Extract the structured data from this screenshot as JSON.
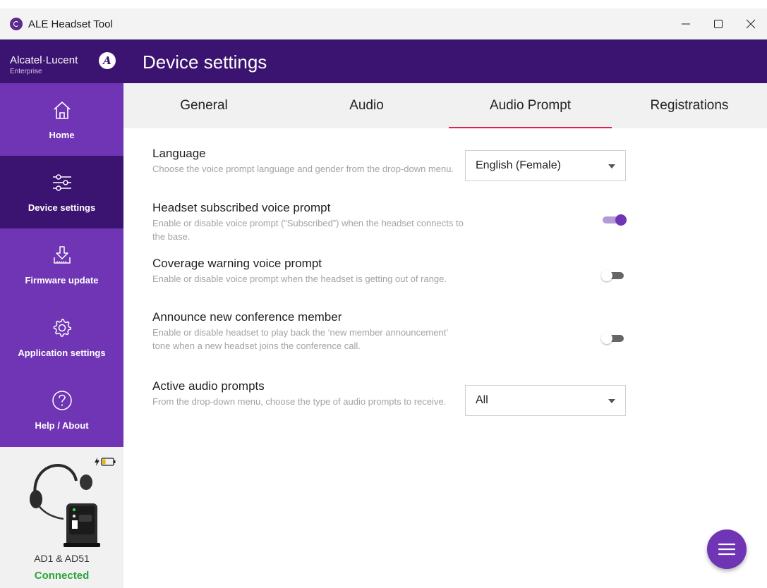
{
  "window": {
    "title": "ALE Headset Tool",
    "controls": {
      "minimize": "—",
      "maximize": "☐",
      "close": "✕"
    }
  },
  "brand": {
    "name": "Alcatel·Lucent",
    "sub": "Enterprise",
    "mark": "A"
  },
  "sidebar": {
    "items": [
      {
        "label": "Home",
        "icon": "home-icon",
        "active": false
      },
      {
        "label": "Device settings",
        "icon": "sliders-icon",
        "active": true
      },
      {
        "label": "Firmware update",
        "icon": "download-icon",
        "active": false
      },
      {
        "label": "Application settings",
        "icon": "gear-icon",
        "active": false
      },
      {
        "label": "Help / About",
        "icon": "help-icon",
        "active": false
      }
    ]
  },
  "device": {
    "name": "AD1 & AD51",
    "status": "Connected",
    "battery_icon": "charging-battery-icon"
  },
  "header": {
    "title": "Device settings"
  },
  "tabs": [
    {
      "label": "General",
      "active": false
    },
    {
      "label": "Audio",
      "active": false
    },
    {
      "label": "Audio Prompt",
      "active": true
    },
    {
      "label": "Registrations",
      "active": false
    }
  ],
  "settings": {
    "language": {
      "title": "Language",
      "desc": "Choose the voice prompt language and gender from the drop-down menu.",
      "value": "English (Female)"
    },
    "subscribed": {
      "title": "Headset subscribed voice prompt",
      "desc": "Enable or disable voice prompt (“Subscribed”) when the headset connects to the base.",
      "enabled": true
    },
    "coverage": {
      "title": "Coverage warning voice prompt",
      "desc": "Enable or disable voice prompt when the headset is getting out of range.",
      "enabled": false
    },
    "conference": {
      "title": "Announce new conference member",
      "desc": "Enable or disable headset to play back the ‘new member announcement’ tone when a new headset joins the conference call.",
      "enabled": false
    },
    "active_prompts": {
      "title": "Active audio prompts",
      "desc": "From the drop-down menu, choose the type of audio prompts to receive.",
      "value": "All"
    }
  },
  "colors": {
    "accent": "#6f35b4",
    "header": "#3b1370",
    "tab_indicator": "#e0204e",
    "status_connected": "#2aa53a"
  }
}
